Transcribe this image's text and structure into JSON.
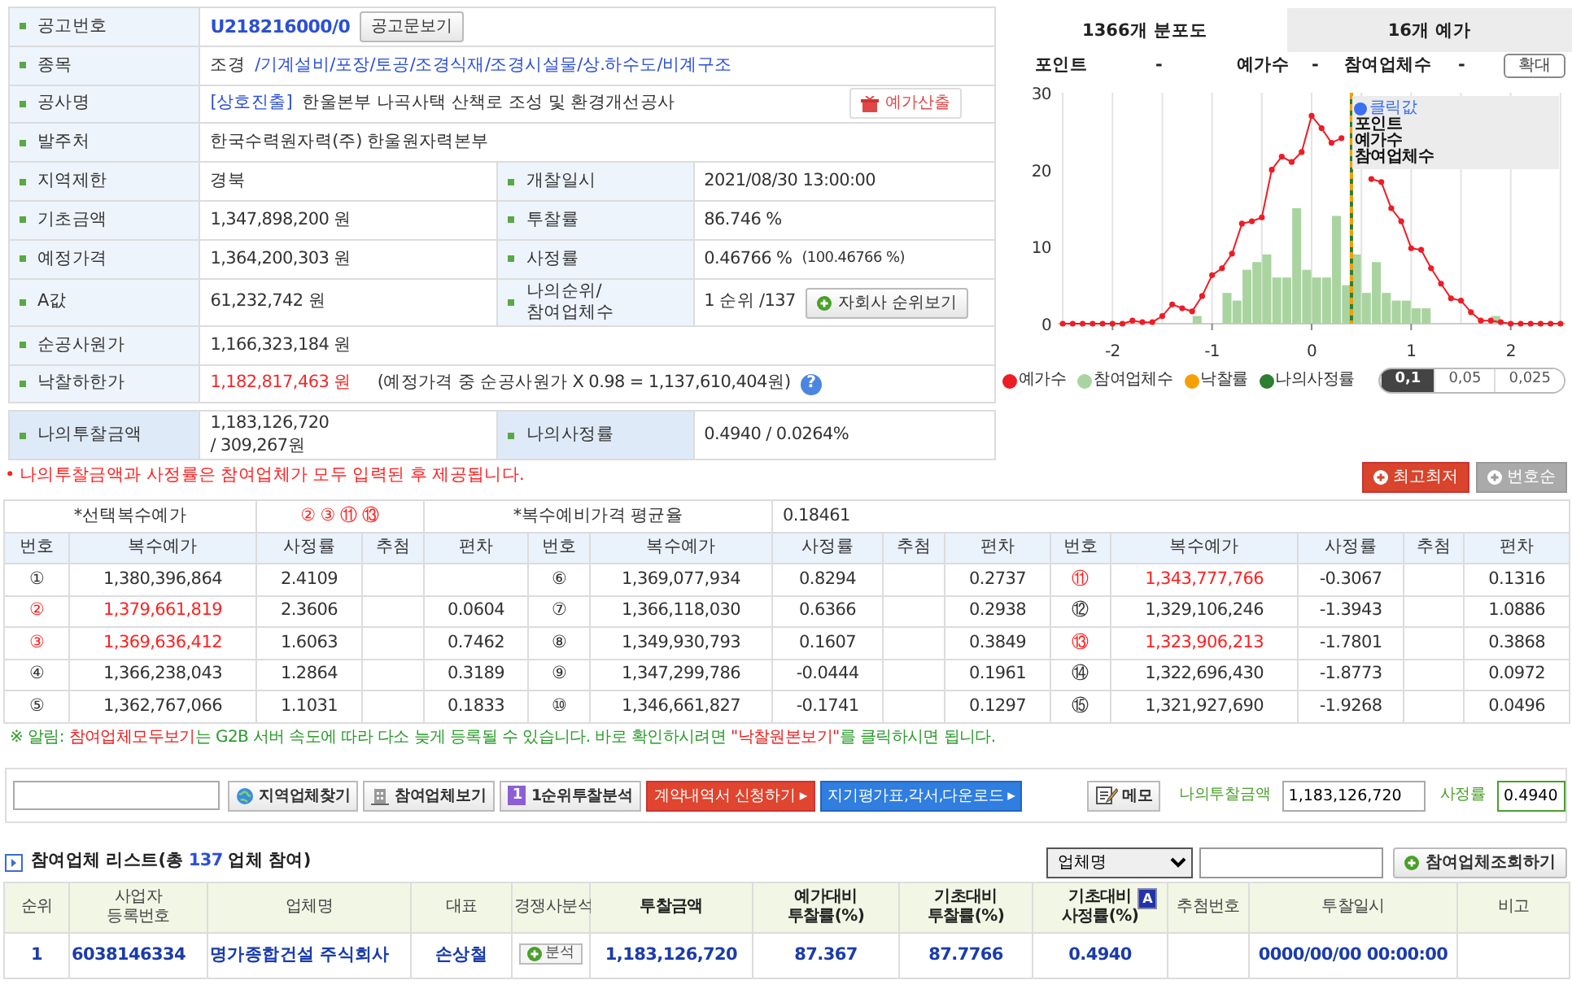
{
  "info": [
    {
      "cells": [
        {
          "label": "공고번호",
          "value": [
            {
              "text": "U218216000/0",
              "kind": "code"
            }
          ],
          "button": {
            "label": "공고문보기",
            "kind": "plain"
          }
        }
      ]
    },
    {
      "cells": [
        {
          "label": "종목",
          "value": [
            {
              "text": "조경"
            },
            {
              "text": "/기계설비/포장/토공/조경식재/조경시설물/상.하수도/비계구조",
              "kind": "link"
            }
          ]
        }
      ]
    },
    {
      "cells": [
        {
          "label": "공사명",
          "value": [
            {
              "text": "[상호진출]",
              "kind": "link"
            },
            {
              "text": "한울본부 나곡사택 산책로 조성 및 환경개선공사"
            }
          ],
          "button": {
            "label": "예가산출",
            "kind": "calc"
          }
        }
      ]
    },
    {
      "cells": [
        {
          "label": "발주처",
          "value": [
            {
              "text": "한국수력원자력(주) 한울원자력본부"
            }
          ]
        }
      ]
    },
    {
      "cells": [
        {
          "label": "지역제한",
          "value": [
            {
              "text": "경북"
            }
          ]
        },
        {
          "label": "개찰일시",
          "value": [
            {
              "text": "2021/08/30 13:00:00"
            }
          ]
        }
      ]
    },
    {
      "cells": [
        {
          "label": "기초금액",
          "value": [
            {
              "text": "1,347,898,200 원"
            }
          ]
        },
        {
          "label": "투찰률",
          "value": [
            {
              "text": "86.746 %"
            }
          ]
        }
      ]
    },
    {
      "cells": [
        {
          "label": "예정가격",
          "value": [
            {
              "text": "1,364,200,303 원"
            }
          ]
        },
        {
          "label": "사정률",
          "value": [
            {
              "text": "0.46766 %"
            },
            {
              "text": "(100.46766 %)",
              "kind": "note"
            }
          ]
        }
      ]
    },
    {
      "cells": [
        {
          "label": "A값",
          "value": [
            {
              "text": "61,232,742 원"
            }
          ]
        },
        {
          "label": "나의순위/ 참여업체수",
          "value": [
            {
              "text": "1 순위 /137"
            }
          ],
          "button": {
            "label": "자회사 순위보기",
            "kind": "rank"
          }
        }
      ]
    },
    {
      "cells": [
        {
          "label": "순공사원가",
          "value": [
            {
              "text": "1,166,323,184 원"
            }
          ]
        }
      ]
    },
    {
      "cells": [
        {
          "label": "낙찰하한가",
          "value": [
            {
              "text": "1,182,817,463 원",
              "kind": "limit"
            },
            {
              "text": "(예정가격 중 순공사원가 X 0.98 = 1,137,610,404원)"
            }
          ],
          "help": "?"
        }
      ]
    }
  ],
  "mine": [
    {
      "label": "나의투찰금액",
      "value": [
        {
          "text": "1,183,126,720"
        },
        {
          "text": "/ 309,267원"
        }
      ]
    },
    {
      "label": "나의사정률",
      "value": [
        {
          "text": "0.4940 / 0.0264%"
        }
      ]
    }
  ],
  "distribution": {
    "tabs": [
      {
        "label": "1366개 분포도",
        "selected": true
      },
      {
        "label": "16개 예가",
        "selected": false
      }
    ],
    "stats": [
      {
        "label": "포인트",
        "value": "-"
      },
      {
        "label": "예가수",
        "value": "-"
      },
      {
        "label": "참여업체수",
        "value": "-"
      }
    ],
    "zoom_button": "확대",
    "chart_data": {
      "type": "line",
      "grid": true,
      "xticks": [
        -2,
        -1,
        0,
        1,
        2
      ],
      "yticks": [
        0,
        10,
        20,
        30
      ],
      "xlim": [
        -2.55,
        2.55
      ],
      "ylim": [
        0,
        30
      ],
      "series": [
        {
          "name": "예가수",
          "color": "#ee1c25",
          "marker": "o",
          "x": [
            -2.5,
            -2.4,
            -2.3,
            -2.2,
            -2.1,
            -2.0,
            -1.9,
            -1.8,
            -1.7,
            -1.6,
            -1.5,
            -1.4,
            -1.3,
            -1.2,
            -1.1,
            -1.0,
            -0.9,
            -0.8,
            -0.7,
            -0.6,
            -0.5,
            -0.4,
            -0.3,
            -0.2,
            -0.1,
            0,
            0.1,
            0.2,
            0.3,
            0.6,
            0.7,
            0.8,
            0.9,
            1.0,
            1.1,
            1.2,
            1.3,
            1.4,
            1.5,
            1.6,
            1.7,
            1.8,
            1.9,
            2.0,
            2.1,
            2.2,
            2.3,
            2.4,
            2.5
          ],
          "values": [
            0,
            0,
            0,
            0,
            0,
            0,
            0,
            0.4,
            0.2,
            0.2,
            1,
            2.5,
            2,
            1.6,
            3.6,
            6.3,
            7.2,
            9.1,
            13,
            13.3,
            13.8,
            20,
            21.7,
            21,
            22.3,
            27,
            25.4,
            23.5,
            24.1,
            18.8,
            18.4,
            15,
            13.3,
            9.8,
            9.6,
            7.2,
            5.2,
            3.3,
            3,
            1.5,
            0.4,
            0.4,
            0.2,
            0,
            0,
            0,
            0,
            0,
            0
          ]
        },
        {
          "name": "참여업체수",
          "color": "#a9d4a0",
          "type": "bar",
          "x": [
            -1.15,
            -0.85,
            -0.75,
            -0.65,
            -0.55,
            -0.45,
            -0.35,
            -0.25,
            -0.15,
            -0.05,
            0.05,
            0.15,
            0.25,
            0.35,
            0.45,
            0.55,
            0.65,
            0.75,
            0.85,
            0.95,
            1.05,
            1.15,
            1.85
          ],
          "values": [
            1,
            4,
            3,
            7,
            8,
            9,
            6,
            6,
            15,
            7,
            6,
            6,
            14,
            5,
            9,
            4,
            8,
            4,
            3,
            3,
            2,
            2,
            1
          ]
        }
      ],
      "ref_lines": [
        {
          "axis": "x",
          "value": 0.4,
          "label": "낙찰률",
          "color": "#f5a000"
        },
        {
          "axis": "x",
          "value": 0.4,
          "label": "나의사정률",
          "color": "#2e7d32"
        }
      ]
    },
    "tooltip": {
      "title": "클릭값",
      "lines": [
        "포인트",
        "예가수",
        "참여업체수"
      ]
    },
    "scales": [
      {
        "label": "0,1",
        "selected": true
      },
      {
        "label": "0,05",
        "selected": false
      },
      {
        "label": "0,025",
        "selected": false
      }
    ]
  },
  "note": "• 나의투찰금액과 사정률은 참여업체가 모두 입력된 후 제공됩니다.",
  "multi": {
    "sort_buttons": [
      {
        "label": "최고최저",
        "selected": true
      },
      {
        "label": "번호순",
        "selected": false
      }
    ],
    "selected_label": "*선택복수예가",
    "selected_numbers": "② ③ ⑪ ⑬",
    "average_label": "*복수예비가격 평균율",
    "average": "0.18461",
    "columns": [
      "번호",
      "복수예가",
      "사정률",
      "추첨",
      "편차",
      "번호",
      "복수예가",
      "사정률",
      "추첨",
      "편차",
      "번호",
      "복수예가",
      "사정률",
      "추첨",
      "편차"
    ],
    "entries": [
      {
        "no": "①",
        "price": "1,380,396,864",
        "rate": "2.4109",
        "selected": false
      },
      {
        "no": "②",
        "price": "1,379,661,819",
        "rate": "2.3606",
        "deviation": "0.0604",
        "selected": true
      },
      {
        "no": "③",
        "price": "1,369,636,412",
        "rate": "1.6063",
        "deviation": "0.7462",
        "selected": true
      },
      {
        "no": "④",
        "price": "1,366,238,043",
        "rate": "1.2864",
        "deviation": "0.3189",
        "selected": false
      },
      {
        "no": "⑤",
        "price": "1,362,767,066",
        "rate": "1.1031",
        "deviation": "0.1833",
        "selected": false
      },
      {
        "no": "⑥",
        "price": "1,369,077,934",
        "rate": "0.8294",
        "deviation": "0.2737",
        "selected": false
      },
      {
        "no": "⑦",
        "price": "1,366,118,030",
        "rate": "0.6366",
        "deviation": "0.2938",
        "selected": false
      },
      {
        "no": "⑧",
        "price": "1,349,930,793",
        "rate": "0.1607",
        "deviation": "0.3849",
        "selected": false
      },
      {
        "no": "⑨",
        "price": "1,347,299,786",
        "rate": "-0.0444",
        "deviation": "0.1961",
        "selected": false
      },
      {
        "no": "⑩",
        "price": "1,346,661,827",
        "rate": "-0.1741",
        "deviation": "0.1297",
        "selected": false
      },
      {
        "no": "⑪",
        "price": "1,343,777,766",
        "rate": "-0.3067",
        "deviation": "0.1316",
        "selected": true
      },
      {
        "no": "⑫",
        "price": "1,329,106,246",
        "rate": "-1.3943",
        "deviation": "1.0886",
        "selected": false
      },
      {
        "no": "⑬",
        "price": "1,323,906,213",
        "rate": "-1.7801",
        "deviation": "0.3868",
        "selected": true
      },
      {
        "no": "⑭",
        "price": "1,322,696,430",
        "rate": "-1.8773",
        "deviation": "0.0972",
        "selected": false
      },
      {
        "no": "⑮",
        "price": "1,321,927,690",
        "rate": "-1.9268",
        "deviation": "0.0496",
        "selected": false
      }
    ]
  },
  "notice": [
    {
      "text": "※ 알림: ",
      "emphasis": false
    },
    {
      "text": "참여업체모두보기",
      "emphasis": true
    },
    {
      "text": "는 G2B 서버 속도에 따라 다소 늦게 등록될 수 있습니다. 바로 확인하시려면 ",
      "emphasis": false
    },
    {
      "text": "\"낙찰원본보기\"",
      "emphasis": true
    },
    {
      "text": "를 클릭하시면 됩니다.",
      "emphasis": false
    }
  ],
  "toolbar": {
    "buttons": [
      {
        "label": "지역업체찾기",
        "kind": "globe"
      },
      {
        "label": "참여업체보기",
        "kind": "building"
      },
      {
        "label": "1순위투찰분석",
        "kind": "badge",
        "badge": "1"
      },
      {
        "label": "계약내역서 신청하기 ▸",
        "kind": "red"
      },
      {
        "label": "지기평가표,각서,다운로드 ▸",
        "kind": "blue"
      },
      {
        "label": "메모",
        "kind": "memo"
      }
    ],
    "my_amount": {
      "label": "나의투찰금액",
      "value": "1,183,126,720"
    },
    "my_rate": {
      "label": "사정률",
      "value": "0.4940"
    }
  },
  "list": {
    "title": "참여업체 리스트(총 ",
    "count": "137",
    "title_end": " 업체 참여)",
    "filter": "업체명",
    "search_button": "참여업체조회하기",
    "columns": [
      {
        "label": "순위"
      },
      {
        "label": "사업자 등록번호"
      },
      {
        "label": "업체명"
      },
      {
        "label": "대표"
      },
      {
        "label": "경쟁사분석"
      },
      {
        "label": "투찰금액",
        "bold": true
      },
      {
        "label": "예가대비 투찰률(%)",
        "bold": true
      },
      {
        "label": "기초대비 투찰률(%)",
        "bold": true
      },
      {
        "label": "기초대비 사정률(%)",
        "bold": true,
        "badge": "A"
      },
      {
        "label": "추첨번호"
      },
      {
        "label": "투찰일시"
      },
      {
        "label": "비고"
      }
    ],
    "rows": [
      {
        "cells": [
          {
            "text": "1"
          },
          {
            "text": "6038146334"
          },
          {
            "text": "명가종합건설 주식회사"
          },
          {
            "text": "손상철"
          },
          {
            "text": "분석",
            "kind": "button"
          },
          {
            "text": "1,183,126,720"
          },
          {
            "text": "87.367"
          },
          {
            "text": "87.7766"
          },
          {
            "text": "0.4940"
          },
          {},
          {
            "text": "0000/00/00 00:00:00"
          },
          {}
        ]
      }
    ]
  }
}
